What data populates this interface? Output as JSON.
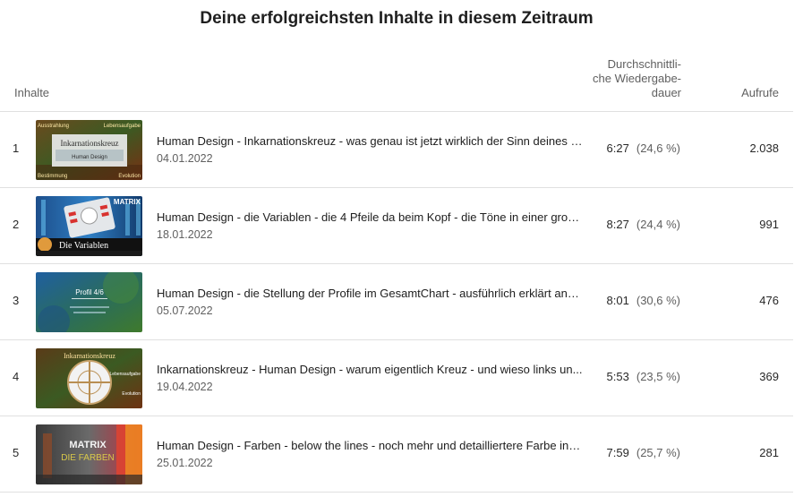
{
  "page": {
    "title": "Deine erfolgreichsten Inhalte in diesem Zeitraum"
  },
  "table": {
    "headers": {
      "content": "Inhalte",
      "avg_duration": "Durchschnittli-\nche Wiedergabe-\ndauer",
      "views": "Aufrufe"
    },
    "rows": [
      {
        "rank": "1",
        "title": "Human Design - Inkarnationskreuz - was genau ist jetzt wirklich der Sinn deines L...",
        "date": "04.01.2022",
        "duration": "6:27",
        "percent": "(24,6 %)",
        "views": "2.038",
        "thumb": {
          "main_text": "Inkarnationskreuz",
          "sub_text": "Human Design",
          "corner_tl": "Ausstrahlung",
          "corner_tr": "Lebensaufgabe",
          "corner_bl": "Bestimmung",
          "corner_br": "Evolution"
        }
      },
      {
        "rank": "2",
        "title": "Human Design - die Variablen - die 4 Pfeile da beim Kopf - die Töne in einer grobe...",
        "date": "18.01.2022",
        "duration": "8:27",
        "percent": "(24,4 %)",
        "views": "991",
        "thumb": {
          "main_text": "Die Variablen",
          "corner_tr": "MATRIX"
        }
      },
      {
        "rank": "3",
        "title": "Human Design - die Stellung der Profile im GesamtChart - ausführlich erklärt anh...",
        "date": "05.07.2022",
        "duration": "8:01",
        "percent": "(30,6 %)",
        "views": "476",
        "thumb": {
          "main_text": "Profil 4/6"
        }
      },
      {
        "rank": "4",
        "title": "Inkarnationskreuz - Human Design - warum eigentlich Kreuz - und wieso links un...",
        "date": "19.04.2022",
        "duration": "5:53",
        "percent": "(23,5 %)",
        "views": "369",
        "thumb": {
          "main_text": "Inkarnationskreuz",
          "corner_r": "Lebensaufgabe",
          "corner_br": "Evolution"
        }
      },
      {
        "rank": "5",
        "title": "Human Design - Farben - below the lines - noch mehr und detailliertere Farbe ins ...",
        "date": "25.01.2022",
        "duration": "7:59",
        "percent": "(25,7 %)",
        "views": "281",
        "thumb": {
          "main_text": "MATRIX",
          "sub_text": "DIE FARBEN"
        }
      }
    ]
  }
}
